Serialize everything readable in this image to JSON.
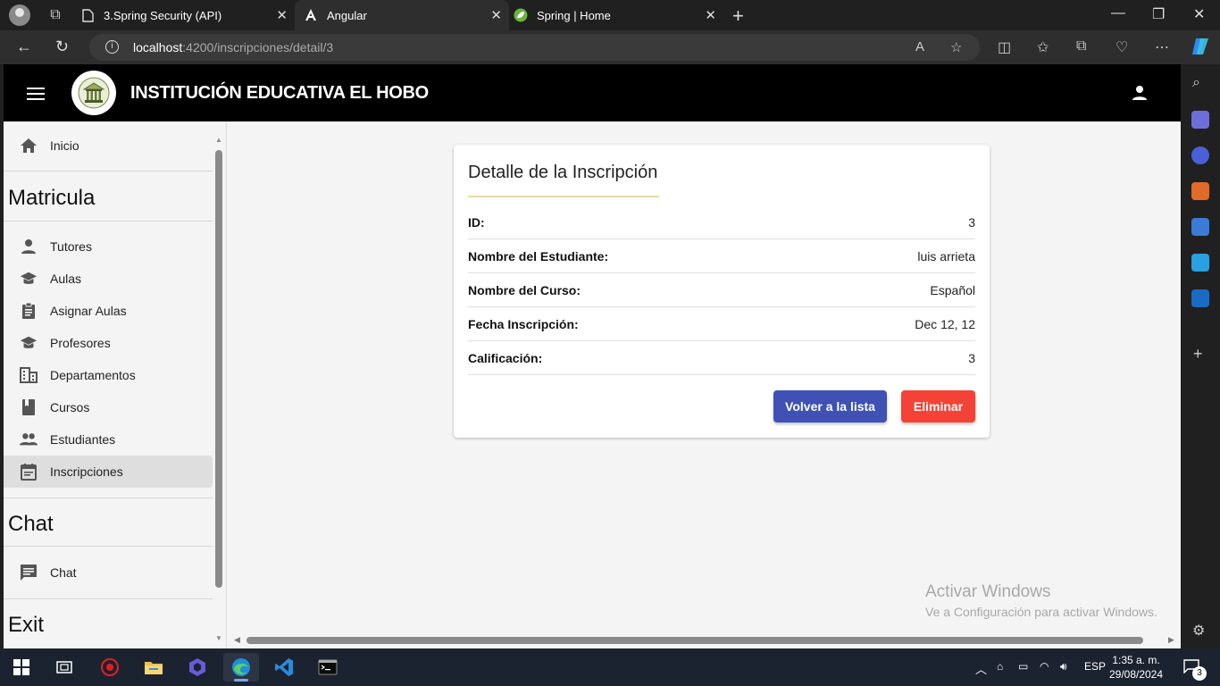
{
  "browser": {
    "tabs": [
      {
        "title": "3.Spring Security (API)",
        "active": false
      },
      {
        "title": "Angular",
        "active": true
      },
      {
        "title": "Spring | Home",
        "active": false
      }
    ],
    "url_host": "localhost",
    "url_path": ":4200/inscripciones/detail/3"
  },
  "app": {
    "title": "INSTITUCIÓN EDUCATIVA EL HOBO"
  },
  "sidebar": {
    "home": "Inicio",
    "sections": [
      {
        "title": "Matricula",
        "items": [
          "Tutores",
          "Aulas",
          "Asignar Aulas",
          "Profesores",
          "Departamentos",
          "Cursos",
          "Estudiantes",
          "Inscripciones"
        ]
      },
      {
        "title": "Chat",
        "items": [
          "Chat"
        ]
      },
      {
        "title": "Exit",
        "items": []
      }
    ],
    "active_item": "Inscripciones"
  },
  "detail": {
    "title": "Detalle de la Inscripción",
    "fields": [
      {
        "label": "ID:",
        "value": "3"
      },
      {
        "label": "Nombre del Estudiante:",
        "value": "luis arrieta"
      },
      {
        "label": "Nombre del Curso:",
        "value": "Español"
      },
      {
        "label": "Fecha Inscripción:",
        "value": "Dec 12, 12"
      },
      {
        "label": "Calificación:",
        "value": "3"
      }
    ],
    "back_button": "Volver a la lista",
    "delete_button": "Eliminar"
  },
  "watermark": {
    "line1": "Activar Windows",
    "line2": "Ve a Configuración para activar Windows."
  },
  "taskbar": {
    "language": "ESP",
    "time": "1:35 a. m.",
    "date": "29/08/2024",
    "notifications": "3"
  },
  "colors": {
    "primary": "#3f51b5",
    "warn": "#f44336",
    "toolbar": "#000000",
    "active_nav": "#dedede"
  }
}
